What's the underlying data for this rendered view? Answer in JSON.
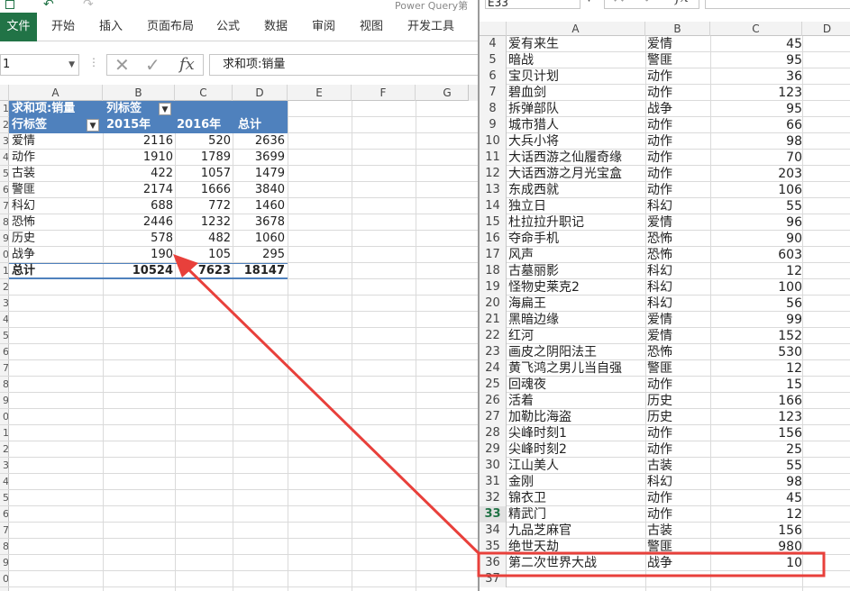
{
  "left": {
    "qat": {
      "title": "Power Query第"
    },
    "ribbon_tabs": [
      "文件",
      "开始",
      "插入",
      "页面布局",
      "公式",
      "数据",
      "审阅",
      "视图",
      "开发工具"
    ],
    "namebox": "1",
    "fx_label": "fx",
    "formula": "求和项:销量",
    "columns": [
      "A",
      "B",
      "C",
      "D",
      "E",
      "F",
      "G"
    ],
    "row_numbers": [
      "1",
      "2",
      "3",
      "4",
      "5",
      "6",
      "7",
      "8",
      "9",
      "0",
      "1",
      "2",
      "3",
      "4",
      "5",
      "6",
      "7",
      "8",
      "9",
      "0",
      "1",
      "2",
      "3",
      "4",
      "5",
      "6",
      "7",
      "8",
      "9",
      "0"
    ],
    "pivot": {
      "value_label": "求和项:销量",
      "col_label": "列标签",
      "row_label": "行标签",
      "col_headers": [
        "2015年",
        "2016年",
        "总计"
      ],
      "rows": [
        {
          "name": "爱情",
          "v2015": "2116",
          "v2016": "520",
          "total": "2636"
        },
        {
          "name": "动作",
          "v2015": "1910",
          "v2016": "1789",
          "total": "3699"
        },
        {
          "name": "古装",
          "v2015": "422",
          "v2016": "1057",
          "total": "1479"
        },
        {
          "name": "警匪",
          "v2015": "2174",
          "v2016": "1666",
          "total": "3840"
        },
        {
          "name": "科幻",
          "v2015": "688",
          "v2016": "772",
          "total": "1460"
        },
        {
          "name": "恐怖",
          "v2015": "2446",
          "v2016": "1232",
          "total": "3678"
        },
        {
          "name": "历史",
          "v2015": "578",
          "v2016": "482",
          "total": "1060"
        },
        {
          "name": "战争",
          "v2015": "190",
          "v2016": "105",
          "total": "295"
        }
      ],
      "total": {
        "name": "总计",
        "v2015": "10524",
        "v2016": "7623",
        "total": "18147"
      }
    }
  },
  "right": {
    "namebox": "E33",
    "fx_label": "fx",
    "columns": [
      "A",
      "B",
      "C",
      "D"
    ],
    "rows": [
      {
        "n": "4",
        "title": "爱有来生",
        "genre": "爱情",
        "sales": "45"
      },
      {
        "n": "5",
        "title": "暗战",
        "genre": "警匪",
        "sales": "95"
      },
      {
        "n": "6",
        "title": "宝贝计划",
        "genre": "动作",
        "sales": "36"
      },
      {
        "n": "7",
        "title": "碧血剑",
        "genre": "动作",
        "sales": "123"
      },
      {
        "n": "8",
        "title": "拆弹部队",
        "genre": "战争",
        "sales": "95"
      },
      {
        "n": "9",
        "title": "城市猎人",
        "genre": "动作",
        "sales": "66"
      },
      {
        "n": "10",
        "title": "大兵小将",
        "genre": "动作",
        "sales": "98"
      },
      {
        "n": "11",
        "title": "大话西游之仙履奇缘",
        "genre": "动作",
        "sales": "70"
      },
      {
        "n": "12",
        "title": "大话西游之月光宝盒",
        "genre": "动作",
        "sales": "203"
      },
      {
        "n": "13",
        "title": "东成西就",
        "genre": "动作",
        "sales": "106"
      },
      {
        "n": "14",
        "title": "独立日",
        "genre": "科幻",
        "sales": "55"
      },
      {
        "n": "15",
        "title": "杜拉拉升职记",
        "genre": "爱情",
        "sales": "96"
      },
      {
        "n": "16",
        "title": "夺命手机",
        "genre": "恐怖",
        "sales": "90"
      },
      {
        "n": "17",
        "title": "风声",
        "genre": "恐怖",
        "sales": "603"
      },
      {
        "n": "18",
        "title": "古墓丽影",
        "genre": "科幻",
        "sales": "12"
      },
      {
        "n": "19",
        "title": "怪物史莱克2",
        "genre": "科幻",
        "sales": "100"
      },
      {
        "n": "20",
        "title": "海扁王",
        "genre": "科幻",
        "sales": "56"
      },
      {
        "n": "21",
        "title": "黑暗边缘",
        "genre": "爱情",
        "sales": "99"
      },
      {
        "n": "22",
        "title": "红河",
        "genre": "爱情",
        "sales": "152"
      },
      {
        "n": "23",
        "title": "画皮之阴阳法王",
        "genre": "恐怖",
        "sales": "530"
      },
      {
        "n": "24",
        "title": "黄飞鸿之男儿当自强",
        "genre": "警匪",
        "sales": "12"
      },
      {
        "n": "25",
        "title": "回魂夜",
        "genre": "动作",
        "sales": "15"
      },
      {
        "n": "26",
        "title": "活着",
        "genre": "历史",
        "sales": "166"
      },
      {
        "n": "27",
        "title": "加勒比海盗",
        "genre": "历史",
        "sales": "123"
      },
      {
        "n": "28",
        "title": "尖峰时刻1",
        "genre": "动作",
        "sales": "156"
      },
      {
        "n": "29",
        "title": "尖峰时刻2",
        "genre": "动作",
        "sales": "25"
      },
      {
        "n": "30",
        "title": "江山美人",
        "genre": "古装",
        "sales": "55"
      },
      {
        "n": "31",
        "title": "金刚",
        "genre": "科幻",
        "sales": "98"
      },
      {
        "n": "32",
        "title": "锦衣卫",
        "genre": "动作",
        "sales": "45"
      },
      {
        "n": "33",
        "title": "精武门",
        "genre": "动作",
        "sales": "12"
      },
      {
        "n": "34",
        "title": "九品芝麻官",
        "genre": "古装",
        "sales": "156"
      },
      {
        "n": "35",
        "title": "绝世天劫",
        "genre": "警匪",
        "sales": "980"
      },
      {
        "n": "36",
        "title": "第二次世界大战",
        "genre": "战争",
        "sales": "10"
      },
      {
        "n": "37",
        "title": "",
        "genre": "",
        "sales": ""
      }
    ]
  },
  "colors": {
    "excel_green": "#217346",
    "pivot_blue": "#4f81bd",
    "annotation_red": "#e8403b"
  }
}
